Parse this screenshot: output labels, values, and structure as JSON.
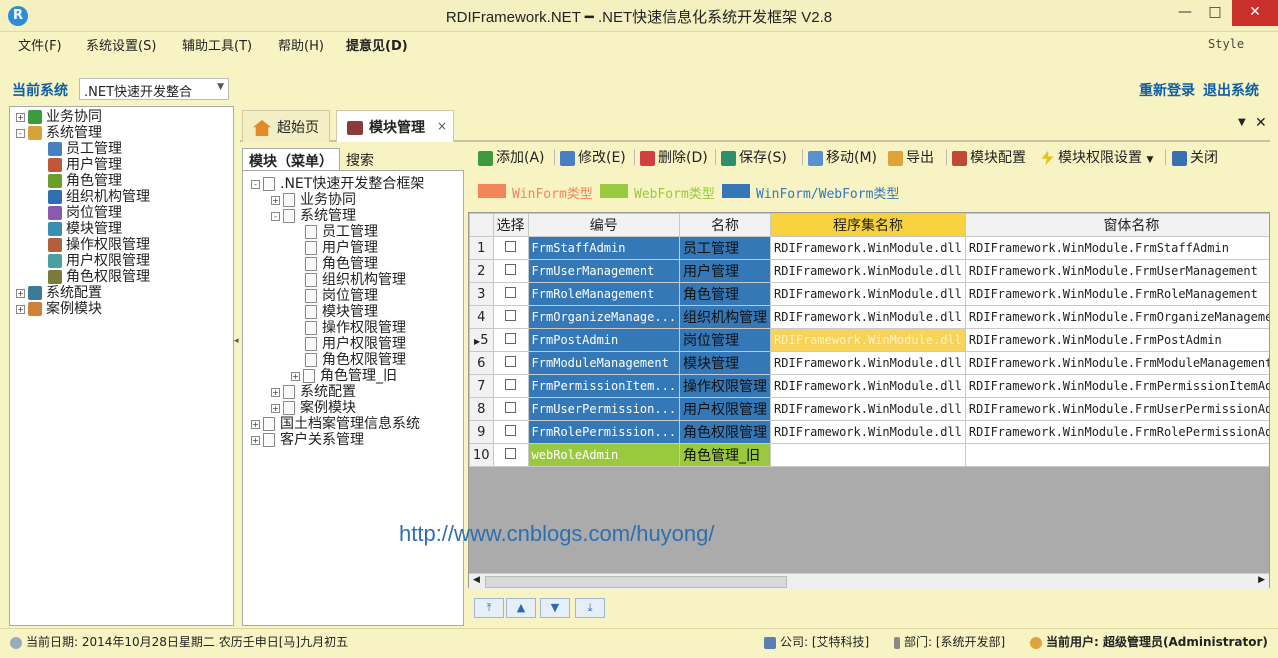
{
  "window": {
    "title": "RDIFramework.NET ━ .NET快速信息化系统开发框架 V2.8",
    "logo_letter": "R",
    "minimize": "—",
    "maximize": "□",
    "close": "✕"
  },
  "menu": {
    "file": "文件(F)",
    "settings": "系统设置(S)",
    "tools": "辅助工具(T)",
    "help": "帮助(H)",
    "suggest": "提意见(D)",
    "style": "Style"
  },
  "system": {
    "label": "当前系统",
    "selected": ".NET快速开发整合",
    "relogin": "重新登录",
    "logout": "退出系统"
  },
  "nav_tree": [
    {
      "label": "业务协同",
      "level": 0,
      "expander": "+"
    },
    {
      "label": "系统管理",
      "level": 0,
      "expander": "-"
    },
    {
      "label": "员工管理",
      "level": 1
    },
    {
      "label": "用户管理",
      "level": 1
    },
    {
      "label": "角色管理",
      "level": 1
    },
    {
      "label": "组织机构管理",
      "level": 1
    },
    {
      "label": "岗位管理",
      "level": 1
    },
    {
      "label": "模块管理",
      "level": 1
    },
    {
      "label": "操作权限管理",
      "level": 1
    },
    {
      "label": "用户权限管理",
      "level": 1
    },
    {
      "label": "角色权限管理",
      "level": 1
    },
    {
      "label": "系统配置",
      "level": 0,
      "expander": "+"
    },
    {
      "label": "案例模块",
      "level": 0,
      "expander": "+"
    }
  ],
  "tabs": {
    "home": "超始页",
    "module": "模块管理",
    "close": "×"
  },
  "module_tabs": {
    "module": "模块（菜单）",
    "search": "搜索"
  },
  "module_tree": [
    {
      "label": ".NET快速开发整合框架",
      "level": 0,
      "expander": "-"
    },
    {
      "label": "业务协同",
      "level": 1,
      "expander": "+"
    },
    {
      "label": "系统管理",
      "level": 1,
      "expander": "-"
    },
    {
      "label": "员工管理",
      "level": 2
    },
    {
      "label": "用户管理",
      "level": 2
    },
    {
      "label": "角色管理",
      "level": 2
    },
    {
      "label": "组织机构管理",
      "level": 2
    },
    {
      "label": "岗位管理",
      "level": 2
    },
    {
      "label": "模块管理",
      "level": 2
    },
    {
      "label": "操作权限管理",
      "level": 2
    },
    {
      "label": "用户权限管理",
      "level": 2
    },
    {
      "label": "角色权限管理",
      "level": 2
    },
    {
      "label": "角色管理_旧",
      "level": 2,
      "expander": "+"
    },
    {
      "label": "系统配置",
      "level": 1,
      "expander": "+"
    },
    {
      "label": "案例模块",
      "level": 1,
      "expander": "+"
    },
    {
      "label": "国土档案管理信息系统",
      "level": 0,
      "expander": "+"
    },
    {
      "label": "客户关系管理",
      "level": 0,
      "expander": "+"
    }
  ],
  "toolbar": {
    "add": "添加(A)",
    "edit": "修改(E)",
    "delete": "删除(D)",
    "save": "保存(S)",
    "move": "移动(M)",
    "export": "导出",
    "config": "模块配置",
    "permission": "模块权限设置",
    "close": "关闭"
  },
  "legend": {
    "winform": "WinForm类型",
    "webform": "WebForm类型",
    "both": "WinForm/WebForm类型",
    "colors": {
      "winform": "#f2855a",
      "webform": "#98c93e",
      "both": "#3478b8"
    }
  },
  "grid": {
    "columns": [
      "选择",
      "编号",
      "名称",
      "程序集名称",
      "窗体名称"
    ],
    "rows": [
      {
        "num": "1",
        "code": "FrmStaffAdmin",
        "name": "员工管理",
        "assembly": "RDIFramework.WinModule.dll",
        "form": "RDIFramework.WinModule.FrmStaffAdmin",
        "type": "win"
      },
      {
        "num": "2",
        "code": "FrmUserManagement",
        "name": "用户管理",
        "assembly": "RDIFramework.WinModule.dll",
        "form": "RDIFramework.WinModule.FrmUserManagement",
        "type": "win"
      },
      {
        "num": "3",
        "code": "FrmRoleManagement",
        "name": "角色管理",
        "assembly": "RDIFramework.WinModule.dll",
        "form": "RDIFramework.WinModule.FrmRoleManagement",
        "type": "win"
      },
      {
        "num": "4",
        "code": "FrmOrganizeManage...",
        "name": "组织机构管理",
        "assembly": "RDIFramework.WinModule.dll",
        "form": "RDIFramework.WinModule.FrmOrganizeManagement",
        "type": "win"
      },
      {
        "num": "5",
        "code": "FrmPostAdmin",
        "name": "岗位管理",
        "assembly": "RDIFramework.WinModule.dll",
        "form": "RDIFramework.WinModule.FrmPostAdmin",
        "type": "win",
        "current": true
      },
      {
        "num": "6",
        "code": "FrmModuleManagement",
        "name": "模块管理",
        "assembly": "RDIFramework.WinModule.dll",
        "form": "RDIFramework.WinModule.FrmModuleManagement",
        "type": "win"
      },
      {
        "num": "7",
        "code": "FrmPermissionItem...",
        "name": "操作权限管理",
        "assembly": "RDIFramework.WinModule.dll",
        "form": "RDIFramework.WinModule.FrmPermissionItemAdmin",
        "type": "win"
      },
      {
        "num": "8",
        "code": "FrmUserPermission...",
        "name": "用户权限管理",
        "assembly": "RDIFramework.WinModule.dll",
        "form": "RDIFramework.WinModule.FrmUserPermissionAdmin",
        "type": "win"
      },
      {
        "num": "9",
        "code": "FrmRolePermission...",
        "name": "角色权限管理",
        "assembly": "RDIFramework.WinModule.dll",
        "form": "RDIFramework.WinModule.FrmRolePermissionAdmin",
        "type": "win"
      },
      {
        "num": "10",
        "code": "webRoleAdmin",
        "name": "角色管理_旧",
        "assembly": "",
        "form": "",
        "type": "web"
      }
    ]
  },
  "watermark": "http://www.cnblogs.com/huyong/",
  "nav_buttons": [
    "⤒",
    "▲",
    "▼",
    "⤓"
  ],
  "status": {
    "date": "当前日期: 2014年10月28日星期二 农历壬申日[马]九月初五",
    "company": "公司: [艾特科技]",
    "department": "部门: [系统开发部]",
    "user": "当前用户: 超级管理员(Administrator)"
  }
}
